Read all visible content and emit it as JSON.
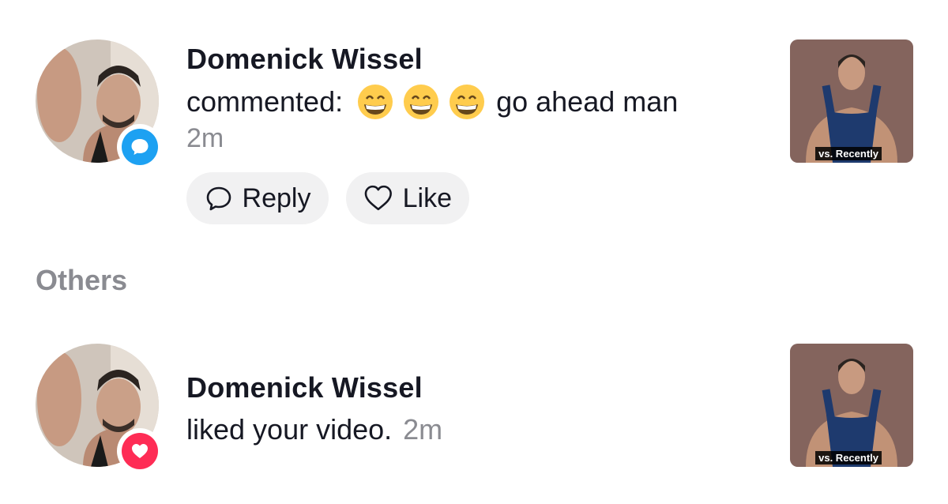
{
  "notifications": [
    {
      "user_name": "Domenick Wissel",
      "action_prefix": "commented:",
      "emojis": [
        "grinning-face-with-smiling-eyes",
        "grinning-face-with-smiling-eyes",
        "grinning-face-with-smiling-eyes"
      ],
      "comment_text": "go ahead man",
      "time": "2m",
      "badge_icon": "comment-icon",
      "badge_color": "#1DA1F2",
      "thumbnail_caption": "vs. Recently",
      "reply_label": "Reply",
      "like_label": "Like"
    },
    {
      "user_name": "Domenick Wissel",
      "action_text": "liked your video.",
      "time": "2m",
      "badge_icon": "heart-icon",
      "badge_color": "#FE2C55",
      "thumbnail_caption": "vs. Recently"
    }
  ],
  "section_title": "Others"
}
